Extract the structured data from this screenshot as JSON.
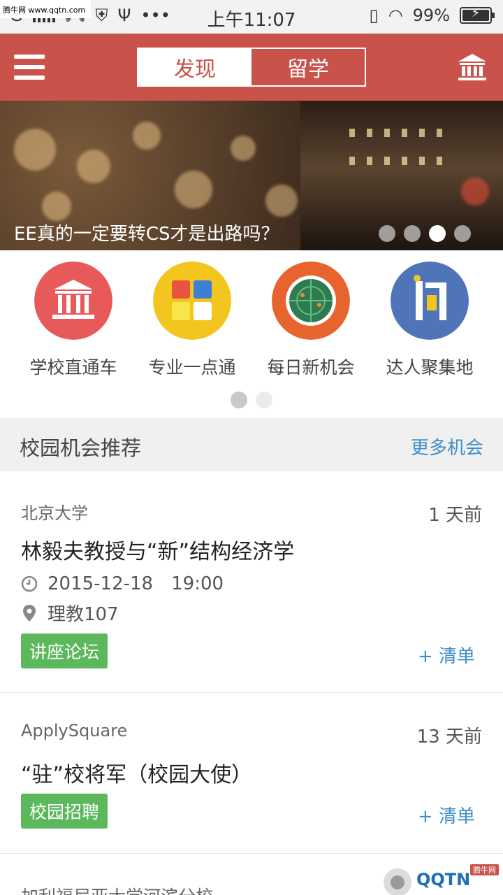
{
  "watermark": {
    "top": "腾牛网 www.qqtn.com",
    "bottom_logo": "QQTN",
    "bottom_tag": "腾牛网"
  },
  "statusbar": {
    "carrier": "G",
    "time": "上午11:07",
    "battery": "99%",
    "battery_level": 0.99
  },
  "header": {
    "tabs": [
      "发现",
      "留学"
    ],
    "active_tab": 0
  },
  "banner": {
    "caption": "EE真的一定要转CS才是出路吗？",
    "slide_count": 4,
    "active_slide": 2
  },
  "categories": {
    "items": [
      {
        "label": "学校直通车",
        "icon": "university-icon",
        "color": "#e85a5a"
      },
      {
        "label": "专业一点通",
        "icon": "grid-blocks-icon",
        "color": "#f2c61f"
      },
      {
        "label": "每日新机会",
        "icon": "radar-icon",
        "color": "#e8642f"
      },
      {
        "label": "达人聚集地",
        "icon": "question-icon",
        "color": "#4f74b8"
      }
    ],
    "page_count": 2,
    "active_page": 0
  },
  "section": {
    "title": "校园机会推荐",
    "more": "更多机会"
  },
  "opportunities": [
    {
      "org": "北京大学",
      "ago": "1 天前",
      "title": "林毅夫教授与“新”结构经济学",
      "date": "2015-12-18",
      "time": "19:00",
      "location": "理教107",
      "tag": "讲座论坛",
      "add": "+ 清单"
    },
    {
      "org": "ApplySquare",
      "ago": "13 天前",
      "title": "“驻”校将军（校园大使）",
      "tag": "校园招聘",
      "add": "+ 清单"
    },
    {
      "org": "加利福尼亚大学河滨分校"
    }
  ],
  "colors": {
    "primary": "#c9534b",
    "link": "#3f8ec9",
    "tag": "#5cb85c"
  }
}
